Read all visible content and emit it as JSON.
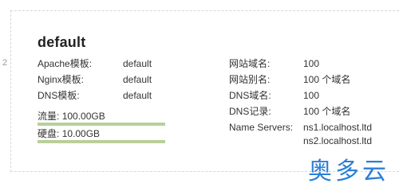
{
  "page": {
    "row_index": "2",
    "title": "default"
  },
  "left": {
    "rows": [
      {
        "label": "Apache模板:",
        "value": "default"
      },
      {
        "label": "Nginx模板:",
        "value": "default"
      },
      {
        "label": "DNS模板:",
        "value": "default"
      }
    ],
    "usage": [
      {
        "label": "流量:",
        "value": "100.00GB"
      },
      {
        "label": "硬盘:",
        "value": "10.00GB"
      }
    ]
  },
  "right": {
    "rows": [
      {
        "label": "网站域名:",
        "value": "100"
      },
      {
        "label": "网站别名:",
        "value": "100 个域名"
      },
      {
        "label": "DNS域名:",
        "value": "100"
      },
      {
        "label": "DNS记录:",
        "value": "100 个域名"
      },
      {
        "label": "Name Servers:",
        "value": "ns1.localhost.ltd"
      },
      {
        "label": "",
        "value": "ns2.localhost.ltd"
      }
    ]
  },
  "watermark": {
    "text": "奥多云"
  }
}
